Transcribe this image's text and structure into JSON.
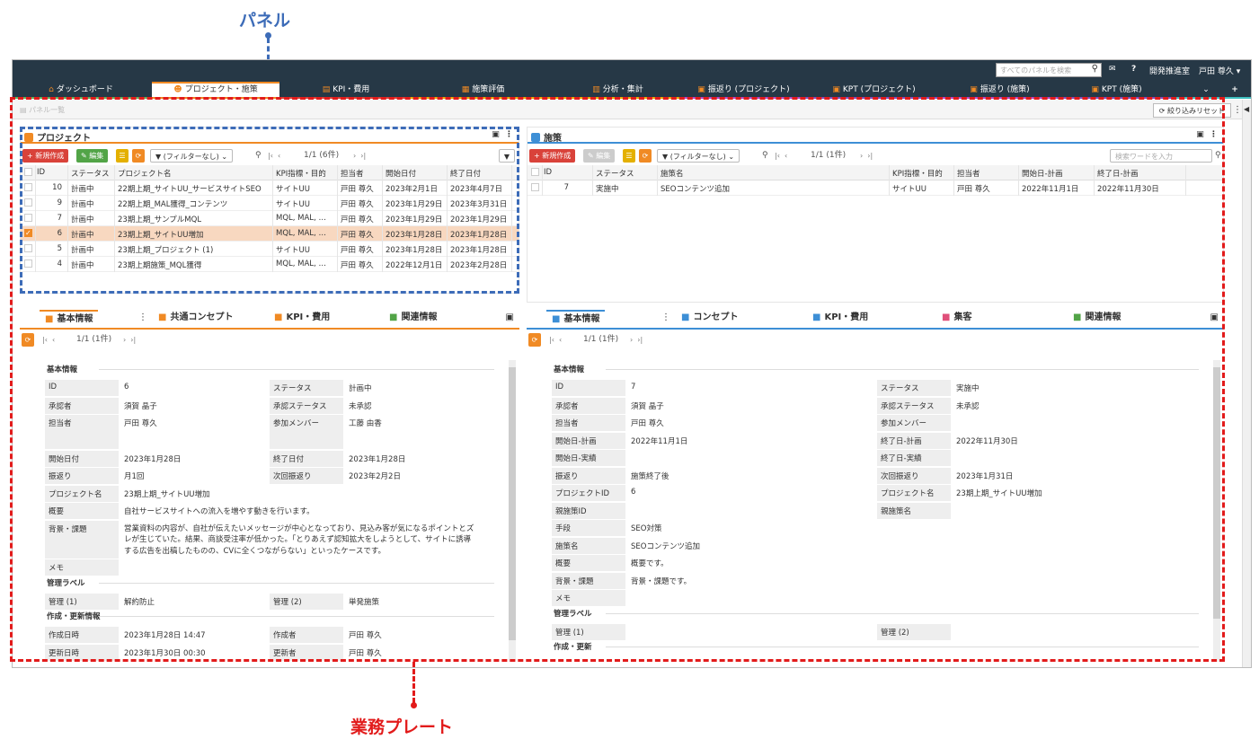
{
  "callouts": {
    "panel": "パネル",
    "plate": "業務プレート"
  },
  "colors": {
    "blue": "#3d6cb8",
    "red": "#e21b1b",
    "nav": "#263846",
    "orange": "#f08a24"
  },
  "topbar": {
    "search_placeholder": "すべてのパネルを検索",
    "help": "?",
    "dept": "開発推進室",
    "user": "戸田 尊久 ▾"
  },
  "tabs": [
    {
      "label": "ダッシュボード",
      "icon": "home-icon"
    },
    {
      "label": "プロジェクト・施策",
      "icon": "person-icon"
    },
    {
      "label": "KPI・費用",
      "icon": "chart-icon"
    },
    {
      "label": "施策評価",
      "icon": "clipboard-icon"
    },
    {
      "label": "分析・集計",
      "icon": "bar-chart-icon"
    },
    {
      "label": "振返り (プロジェクト)",
      "icon": "book-icon"
    },
    {
      "label": "KPT (プロジェクト)",
      "icon": "kpt-icon"
    },
    {
      "label": "振返り (施策)",
      "icon": "book-icon"
    },
    {
      "label": "KPT (施策)",
      "icon": "kpt-icon"
    }
  ],
  "tab_more": "⌄",
  "tab_add": "+",
  "subbar": {
    "panel_list": "パネル一覧",
    "reset": "絞り込みリセット"
  },
  "left_panel": {
    "title": "プロジェクト",
    "new": "+ 新規作成",
    "edit": "✎ 編集",
    "filter": "▼ (フィルターなし) ⌄",
    "pager": "1/1 (6件)",
    "columns": [
      "ID",
      "ステータス",
      "プロジェクト名",
      "KPI指標・目的",
      "担当者",
      "開始日付",
      "終了日付"
    ],
    "rows": [
      {
        "id": "10",
        "status": "計画中",
        "name": "22期上期_サイトUU_サービスサイトSEO",
        "kpi": "サイトUU",
        "owner": "戸田 尊久",
        "start": "2023年2月1日",
        "end": "2023年4月7日",
        "selected": false
      },
      {
        "id": "9",
        "status": "計画中",
        "name": "22期上期_MAL獲得_コンテンツ",
        "kpi": "サイトUU",
        "owner": "戸田 尊久",
        "start": "2023年1月29日",
        "end": "2023年3月31日",
        "selected": false
      },
      {
        "id": "7",
        "status": "計画中",
        "name": "23期上期_サンプルMQL",
        "kpi": "MQL, MAL, …",
        "owner": "戸田 尊久",
        "start": "2023年1月29日",
        "end": "2023年1月29日",
        "selected": false
      },
      {
        "id": "6",
        "status": "計画中",
        "name": "23期上期_サイトUU増加",
        "kpi": "MQL, MAL, …",
        "owner": "戸田 尊久",
        "start": "2023年1月28日",
        "end": "2023年1月28日",
        "selected": true
      },
      {
        "id": "5",
        "status": "計画中",
        "name": "23期上期_プロジェクト (1)",
        "kpi": "サイトUU",
        "owner": "戸田 尊久",
        "start": "2023年1月28日",
        "end": "2023年1月28日",
        "selected": false
      },
      {
        "id": "4",
        "status": "計画中",
        "name": "23期上期施策_MQL獲得",
        "kpi": "MQL, MAL, …",
        "owner": "戸田 尊久",
        "start": "2022年12月1日",
        "end": "2023年2月28日",
        "selected": false
      }
    ]
  },
  "right_panel": {
    "title": "施策",
    "new": "+ 新規作成",
    "edit": "✎ 編集",
    "filter": "▼ (フィルターなし) ⌄",
    "pager": "1/1 (1件)",
    "search_placeholder": "検索ワードを入力",
    "columns": [
      "ID",
      "ステータス",
      "施策名",
      "KPI指標・目的",
      "担当者",
      "開始日-計画",
      "終了日-計画"
    ],
    "rows": [
      {
        "id": "7",
        "status": "実施中",
        "name": "SEOコンテンツ追加",
        "kpi": "サイトUU",
        "owner": "戸田 尊久",
        "start": "2022年11月1日",
        "end": "2022年11月30日"
      }
    ]
  },
  "left_detail": {
    "tabs": [
      "基本情報",
      "共通コンセプト",
      "KPI・費用",
      "関連情報"
    ],
    "pager": "1/1 (1件)",
    "section_basic": "基本情報",
    "fields": [
      {
        "l1": "ID",
        "v1": "6",
        "l2": "ステータス",
        "v2": "計画中"
      },
      {
        "l1": "承認者",
        "v1": "須賀 晶子",
        "l2": "承認ステータス",
        "v2": "未承認"
      },
      {
        "l1": "担当者",
        "v1": "戸田 尊久",
        "l2": "参加メンバー",
        "v2": "工藤 由香"
      },
      {
        "l1": "開始日付",
        "v1": "2023年1月28日",
        "l2": "終了日付",
        "v2": "2023年1月28日"
      },
      {
        "l1": "振返り",
        "v1": "月1回",
        "l2": "次回振返り",
        "v2": "2023年2月2日"
      }
    ],
    "project_name_label": "プロジェクト名",
    "project_name": "23期上期_サイトUU増加",
    "overview_label": "概要",
    "overview": "自社サービスサイトへの流入を増やす動きを行います。",
    "bg_label": "背景・課題",
    "bg_lines": [
      "営業資料の内容が、自社が伝えたいメッセージが中心となっており、見込み客が気になるポイントとズ",
      "レが生じていた。結果、商談受注率が低かった。「とりあえず認知拡大をしようとして、サイトに誘導",
      "する広告を出稿したものの、CVに全くつながらない」といったケースです。"
    ],
    "memo_label": "メモ",
    "section_mgmt": "管理ラベル",
    "mgmt": {
      "l1": "管理 (1)",
      "v1": "解約防止",
      "l2": "管理 (2)",
      "v2": "単発施策"
    },
    "section_update": "作成・更新情報",
    "updates": [
      {
        "l1": "作成日時",
        "v1": "2023年1月28日 14:47",
        "l2": "作成者",
        "v2": "戸田 尊久"
      },
      {
        "l1": "更新日時",
        "v1": "2023年1月30日 00:30",
        "l2": "更新者",
        "v2": "戸田 尊久"
      }
    ]
  },
  "right_detail": {
    "tabs": [
      "基本情報",
      "コンセプト",
      "KPI・費用",
      "集客",
      "関連情報"
    ],
    "pager": "1/1 (1件)",
    "section_basic": "基本情報",
    "fields": [
      {
        "l1": "ID",
        "v1": "7",
        "l2": "ステータス",
        "v2": "実施中"
      },
      {
        "l1": "承認者",
        "v1": "須賀 晶子",
        "l2": "承認ステータス",
        "v2": "未承認"
      },
      {
        "l1": "担当者",
        "v1": "戸田 尊久",
        "l2": "参加メンバー",
        "v2": ""
      },
      {
        "l1": "開始日-計画",
        "v1": "2022年11月1日",
        "l2": "終了日-計画",
        "v2": "2022年11月30日"
      },
      {
        "l1": "開始日-実績",
        "v1": "",
        "l2": "終了日-実績",
        "v2": ""
      },
      {
        "l1": "振返り",
        "v1": "施策終了後",
        "l2": "次回振返り",
        "v2": "2023年1月31日"
      },
      {
        "l1": "プロジェクトID",
        "v1": "6",
        "l2": "プロジェクト名",
        "v2": "23期上期_サイトUU増加"
      },
      {
        "l1": "親施策ID",
        "v1": "",
        "l2": "親施策名",
        "v2": ""
      }
    ],
    "single": [
      {
        "l": "手段",
        "v": "SEO対策"
      },
      {
        "l": "施策名",
        "v": "SEOコンテンツ追加"
      },
      {
        "l": "概要",
        "v": "概要です。"
      },
      {
        "l": "背景・課題",
        "v": "背景・課題です。"
      },
      {
        "l": "メモ",
        "v": ""
      }
    ],
    "section_mgmt": "管理ラベル",
    "mgmt": {
      "l1": "管理 (1)",
      "v1": "",
      "l2": "管理 (2)",
      "v2": ""
    },
    "section_update": "作成・更新"
  }
}
